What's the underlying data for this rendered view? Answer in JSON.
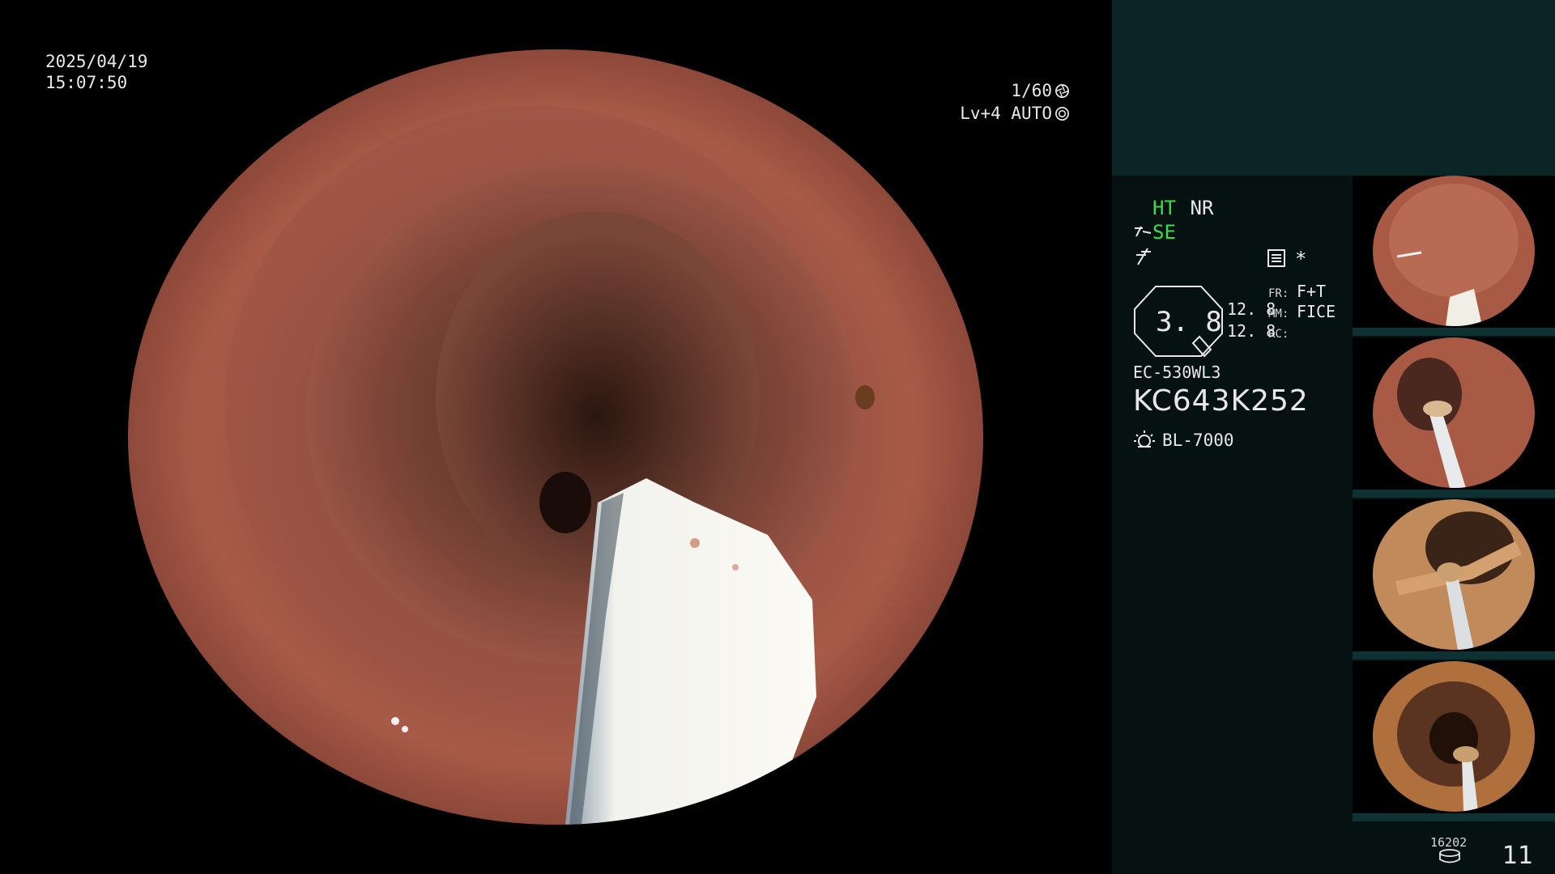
{
  "overlay": {
    "date": "2025/04/19",
    "time": "15:07:50",
    "shutter": "1/60",
    "level": "Lv+4 AUTO",
    "shutter_icon": "aperture-icon",
    "auto_icon": "iris-icon"
  },
  "settings": {
    "ht": "HT",
    "nr": "NR",
    "se": "SE",
    "zoom_value": "3. 8",
    "values": [
      "12. 8",
      "12. 8"
    ],
    "fr_label": "FR:",
    "fr_value": "F+T",
    "mm_label": "MM:",
    "mm_value": "FICE",
    "rc_label": "RC:",
    "star": "*"
  },
  "scope": {
    "model": "EC-530WL3",
    "serial": "KC643K252",
    "light_source": "BL-7000"
  },
  "footer": {
    "storage_count": "16202",
    "image_index": "11"
  },
  "thumbnails": [
    {
      "name": "thumbnail-1"
    },
    {
      "name": "thumbnail-2"
    },
    {
      "name": "thumbnail-3"
    },
    {
      "name": "thumbnail-4"
    }
  ],
  "colors": {
    "green_indicator": "#3ddc4a",
    "panel_bg": "#061112",
    "panel_top_bg": "#0b2527"
  }
}
